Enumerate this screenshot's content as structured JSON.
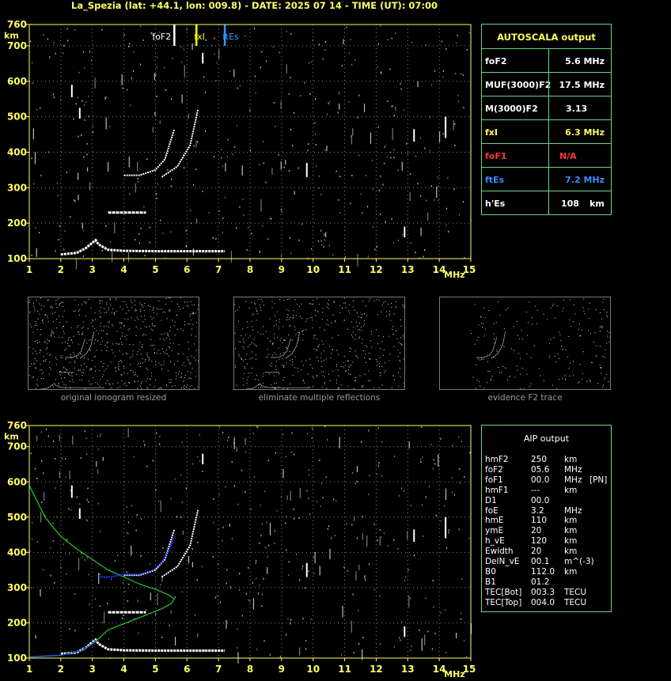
{
  "title": "La_Spezia (lat: +44.1, lon: 009.8) - DATE: 2025 07 14 - TIME (UT): 07:00",
  "chart_data": [
    {
      "type": "scatter",
      "name_id": "top-ionogram",
      "xlim": [
        1,
        15
      ],
      "ylim": [
        100,
        760
      ],
      "x_ticks": [
        1,
        2,
        3,
        4,
        5,
        6,
        7,
        8,
        9,
        10,
        11,
        12,
        13,
        14,
        15
      ],
      "y_ticks": [
        100,
        200,
        300,
        400,
        500,
        600,
        700,
        760
      ],
      "xunit": "MHz",
      "yunit": "km",
      "markers": [
        {
          "label": "foF2",
          "x": 5.6,
          "color": "#ffffff"
        },
        {
          "label": "fxI",
          "x": 6.3,
          "color": "#ffff00"
        },
        {
          "label": "ftEs",
          "x": 7.2,
          "color": "#3399ff"
        }
      ],
      "traces": {
        "E_layer": [
          [
            2,
            112
          ],
          [
            2.5,
            116
          ],
          [
            2.8,
            130
          ],
          [
            3.0,
            145
          ],
          [
            3.1,
            152
          ],
          [
            3.2,
            140
          ],
          [
            3.5,
            125
          ],
          [
            4,
            122
          ],
          [
            5,
            121
          ],
          [
            6,
            121
          ],
          [
            7.2,
            121
          ]
        ],
        "Es_second": [
          [
            3.5,
            230
          ],
          [
            4.0,
            230
          ],
          [
            4.7,
            230
          ]
        ],
        "F2_o": [
          [
            4.0,
            335
          ],
          [
            4.5,
            335
          ],
          [
            5.0,
            350
          ],
          [
            5.3,
            380
          ],
          [
            5.6,
            465
          ]
        ],
        "F2_x": [
          [
            5.2,
            330
          ],
          [
            5.7,
            360
          ],
          [
            6.1,
            420
          ],
          [
            6.35,
            520
          ]
        ]
      }
    },
    {
      "type": "scatter",
      "name_id": "bottom-ionogram",
      "xlim": [
        1,
        15
      ],
      "ylim": [
        100,
        760
      ],
      "x_ticks": [
        1,
        2,
        3,
        4,
        5,
        6,
        7,
        8,
        9,
        10,
        11,
        12,
        13,
        14,
        15
      ],
      "y_ticks": [
        100,
        200,
        300,
        400,
        500,
        600,
        700,
        760
      ],
      "xunit": "MHz",
      "yunit": "km",
      "profile_green": [
        [
          1.0,
          590
        ],
        [
          1.5,
          500
        ],
        [
          2.0,
          445
        ],
        [
          2.5,
          410
        ],
        [
          3.0,
          380
        ],
        [
          3.5,
          350
        ],
        [
          4.0,
          330
        ],
        [
          4.5,
          310
        ],
        [
          5.0,
          295
        ],
        [
          5.4,
          280
        ],
        [
          5.6,
          268
        ],
        [
          5.5,
          255
        ],
        [
          5.2,
          240
        ],
        [
          4.5,
          215
        ],
        [
          3.5,
          180
        ],
        [
          3.2,
          155
        ],
        [
          3.0,
          140
        ],
        [
          2.7,
          122
        ],
        [
          2.0,
          108
        ],
        [
          1.0,
          103
        ]
      ],
      "fit_blue": [
        [
          3.2,
          330
        ],
        [
          3.6,
          330
        ],
        [
          4.0,
          338
        ],
        [
          4.5,
          338
        ],
        [
          4.9,
          348
        ],
        [
          5.2,
          370
        ],
        [
          5.45,
          410
        ],
        [
          5.6,
          445
        ]
      ],
      "fit_blue_e": [
        [
          1.0,
          103
        ],
        [
          2.0,
          108
        ],
        [
          2.6,
          120
        ],
        [
          3.0,
          140
        ],
        [
          3.1,
          152
        ]
      ]
    }
  ],
  "autoscala": {
    "header": "AUTOSCALA output",
    "rows": [
      {
        "key": "foF2",
        "value": "5.6 MHz",
        "kcolor": "#ffffff",
        "vcolor": "#ffffff"
      },
      {
        "key": "MUF(3000)F2",
        "value": "17.5 MHz",
        "kcolor": "#ffffff",
        "vcolor": "#ffffff"
      },
      {
        "key": "M(3000)F2",
        "value": "3.13",
        "kcolor": "#ffffff",
        "vcolor": "#ffffff"
      },
      {
        "key": "fxI",
        "value": "6.3 MHz",
        "kcolor": "#ffff55",
        "vcolor": "#ffff55"
      },
      {
        "key": "foF1",
        "value": "N/A",
        "kcolor": "#ff3333",
        "vcolor": "#ff3333"
      },
      {
        "key": "ftEs",
        "value": "7.2 MHz",
        "kcolor": "#3d8bff",
        "vcolor": "#3d8bff"
      },
      {
        "key": "h'Es",
        "value": "108",
        "unit": "km",
        "kcolor": "#ffffff",
        "vcolor": "#ffffff"
      }
    ]
  },
  "aip": {
    "header": "AIP output",
    "rows": [
      {
        "k": "hmF2",
        "v": "250",
        "u": "km",
        "x": ""
      },
      {
        "k": "foF2",
        "v": "05.6",
        "u": "MHz",
        "x": ""
      },
      {
        "k": "foF1",
        "v": "00.0",
        "u": "MHz",
        "x": "[PN]"
      },
      {
        "k": "hmF1",
        "v": "---",
        "u": "km",
        "x": ""
      },
      {
        "k": "D1",
        "v": "00.0",
        "u": "",
        "x": ""
      },
      {
        "k": "foE",
        "v": "3.2",
        "u": "MHz",
        "x": ""
      },
      {
        "k": "hmE",
        "v": "110",
        "u": "km",
        "x": ""
      },
      {
        "k": "ymE",
        "v": "20",
        "u": "km",
        "x": ""
      },
      {
        "k": "h_vE",
        "v": "120",
        "u": "km",
        "x": ""
      },
      {
        "k": "Ewidth",
        "v": "20",
        "u": "km",
        "x": ""
      },
      {
        "k": "DelN_vE",
        "v": "00.1",
        "u": "m^(-3)",
        "x": ""
      },
      {
        "k": "B0",
        "v": "112.0",
        "u": "km",
        "x": ""
      },
      {
        "k": "B1",
        "v": "01.2",
        "u": "",
        "x": ""
      },
      {
        "k": "TEC[Bot]",
        "v": "003.3",
        "u": "TECU",
        "x": ""
      },
      {
        "k": "TEC[Top]",
        "v": "004.0",
        "u": "TECU",
        "x": ""
      }
    ]
  },
  "thumbnails": [
    {
      "caption": "original ionogram resized"
    },
    {
      "caption": "eliminate multiple reflections"
    },
    {
      "caption": "evidence F2 trace"
    }
  ],
  "colors": {
    "axis": "#ffff66",
    "grid": "#888888",
    "trace": "#ffffff",
    "profile": "#22cc22",
    "fit": "#2233ff",
    "panel_border": "#6fd28a"
  }
}
